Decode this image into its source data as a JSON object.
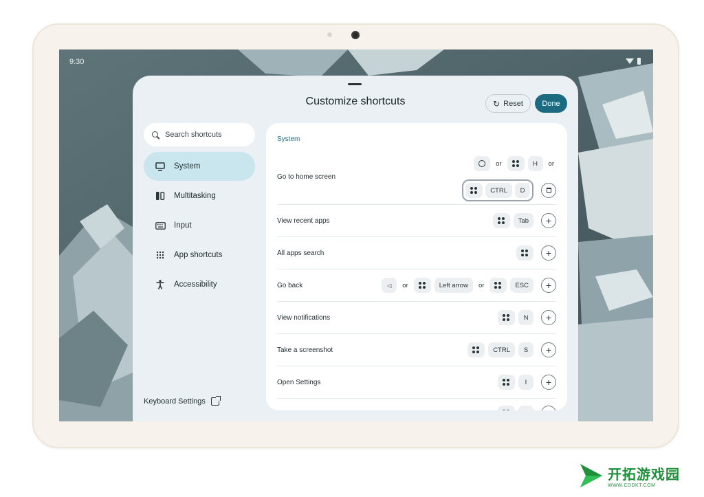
{
  "status_bar": {
    "time": "9:30"
  },
  "dialog": {
    "title": "Customize shortcuts",
    "reset_label": "Reset",
    "done_label": "Done"
  },
  "search": {
    "placeholder": "Search shortcuts"
  },
  "nav": {
    "items": [
      {
        "label": "System",
        "icon": "monitor-icon",
        "active": true
      },
      {
        "label": "Multitasking",
        "icon": "split-screen-icon",
        "active": false
      },
      {
        "label": "Input",
        "icon": "keyboard-icon",
        "active": false
      },
      {
        "label": "App shortcuts",
        "icon": "apps-grid-icon",
        "active": false
      },
      {
        "label": "Accessibility",
        "icon": "accessibility-icon",
        "active": false
      }
    ]
  },
  "keyboard_settings_label": "Keyboard Settings",
  "panel": {
    "section_title": "System",
    "or_word": "or",
    "shortcuts": [
      {
        "label": "Go to home screen",
        "line1": [
          "home-circle-icon",
          "or",
          "meta-key-icon",
          "H",
          "or"
        ],
        "line2": [
          "meta-key-icon",
          "CTRL",
          "D"
        ],
        "action": "delete"
      },
      {
        "label": "View recent apps",
        "keys": [
          "meta-key-icon",
          "Tab"
        ],
        "action": "add"
      },
      {
        "label": "All apps search",
        "keys": [
          "meta-key-icon"
        ],
        "action": "add"
      },
      {
        "label": "Go back",
        "keys": [
          "back-triangle-icon",
          "or",
          "meta-key-icon",
          "Left arrow",
          "or",
          "meta-key-icon",
          "ESC"
        ],
        "action": "add"
      },
      {
        "label": "View notifications",
        "keys": [
          "meta-key-icon",
          "N"
        ],
        "action": "add"
      },
      {
        "label": "Take a screenshot",
        "keys": [
          "meta-key-icon",
          "CTRL",
          "S"
        ],
        "action": "add"
      },
      {
        "label": "Open Settings",
        "keys": [
          "meta-key-icon",
          "I"
        ],
        "action": "add"
      }
    ]
  },
  "watermark": {
    "name": "开拓游戏园",
    "url": "WWW.CDDKT.COM"
  },
  "colors": {
    "accent": "#1d6b80",
    "nav_active": "#c9e6ef",
    "sheet_bg": "#eaf0f3",
    "watermark": "#1f8f3a"
  }
}
